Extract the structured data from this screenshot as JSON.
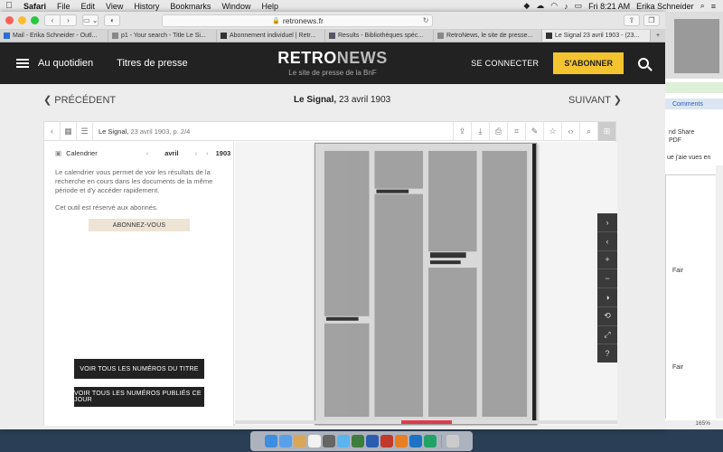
{
  "menubar": {
    "app": "Safari",
    "items": [
      "File",
      "Edit",
      "View",
      "History",
      "Bookmarks",
      "Window",
      "Help"
    ],
    "clock": "Fri 8:21 AM",
    "user": "Erika Schneider"
  },
  "browser": {
    "url": "retronews.fr",
    "tabs": [
      "Mail - Erika Schneider - Outl...",
      "p1 - Your search - Title Le Si...",
      "Abonnement individuel | Retr...",
      "Results - Bibliothèques spéc...",
      "RetroNews, le site de presse...",
      "Le Signal 23 avril 1903 - (23..."
    ]
  },
  "site": {
    "nav": [
      "Au quotidien",
      "Titres de presse"
    ],
    "logo_retro": "RETRO",
    "logo_news": "NEWS",
    "logo_sub": "Le site de presse de la BnF",
    "connect": "SE CONNECTER",
    "subscribe": "S'ABONNER"
  },
  "issue": {
    "prev": "PRÉCÉDENT",
    "next": "SUIVANT",
    "title_bold": "Le Signal,",
    "title_date": " 23 avril 1903"
  },
  "viewer": {
    "doc_title": "Le Signal,",
    "doc_meta": " 23 avril 1903, p. 2/4",
    "calendar_label": "Calendrier",
    "month": "avril",
    "year": "1903",
    "calendar_text": "Le calendrier vous permet de voir les résultats de la recherche en cours dans les documents de la même période et d'y accéder rapidement.",
    "calendar_note": "Cet outil est réservé aux abonnés.",
    "subscribe_btn": "ABONNEZ-VOUS",
    "btn_all_title": "VOIR TOUS LES NUMÉROS DU TITRE",
    "btn_all_day": "VOIR TOUS LES NUMÉROS PUBLIÉS CE JOUR",
    "page_progress": 0.5
  },
  "background_window": {
    "comments": "Comments",
    "share": "nd Share",
    "pdf": "PDF",
    "search_hint": "ue j'aie vues en",
    "fair_1": "Fair",
    "fair_2": "Fair",
    "zoom": "165%"
  },
  "colors": {
    "accent_yellow": "#f4c430",
    "progress_red": "#e03b4a",
    "header_dark": "#222222"
  }
}
